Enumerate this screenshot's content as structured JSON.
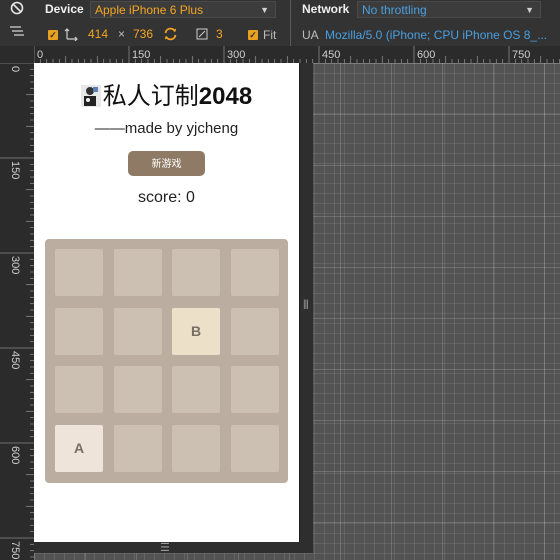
{
  "toolbar": {
    "device_label": "Device",
    "device_value": "Apple iPhone 6 Plus",
    "width": "414",
    "times": "×",
    "height": "736",
    "pixel_ratio": "3",
    "fit_label": "Fit",
    "network_label": "Network",
    "network_value": "No throttling",
    "ua_label": "UA",
    "ua_value": "Mozilla/5.0 (iPhone; CPU iPhone OS 8_..."
  },
  "ruler_top": [
    "0",
    "150",
    "300",
    "450",
    "600",
    "750"
  ],
  "ruler_left": [
    "0",
    "150",
    "300",
    "450",
    "600",
    "750"
  ],
  "game": {
    "title_cn": "私人订制",
    "title_num": "2048",
    "subtitle": "——made by yjcheng",
    "new_game_label": "新游戏",
    "score_text": "score: 0",
    "grid": [
      [
        "",
        "",
        "",
        ""
      ],
      [
        "",
        "",
        "B",
        ""
      ],
      [
        "",
        "",
        "",
        ""
      ],
      [
        "A",
        "",
        "",
        ""
      ]
    ]
  },
  "colors": {
    "accent_orange": "#f5a623",
    "link_blue": "#4a9fe0",
    "board": "#bbada0",
    "empty_cell": "#ccc0b3",
    "button": "#8f7a66"
  }
}
